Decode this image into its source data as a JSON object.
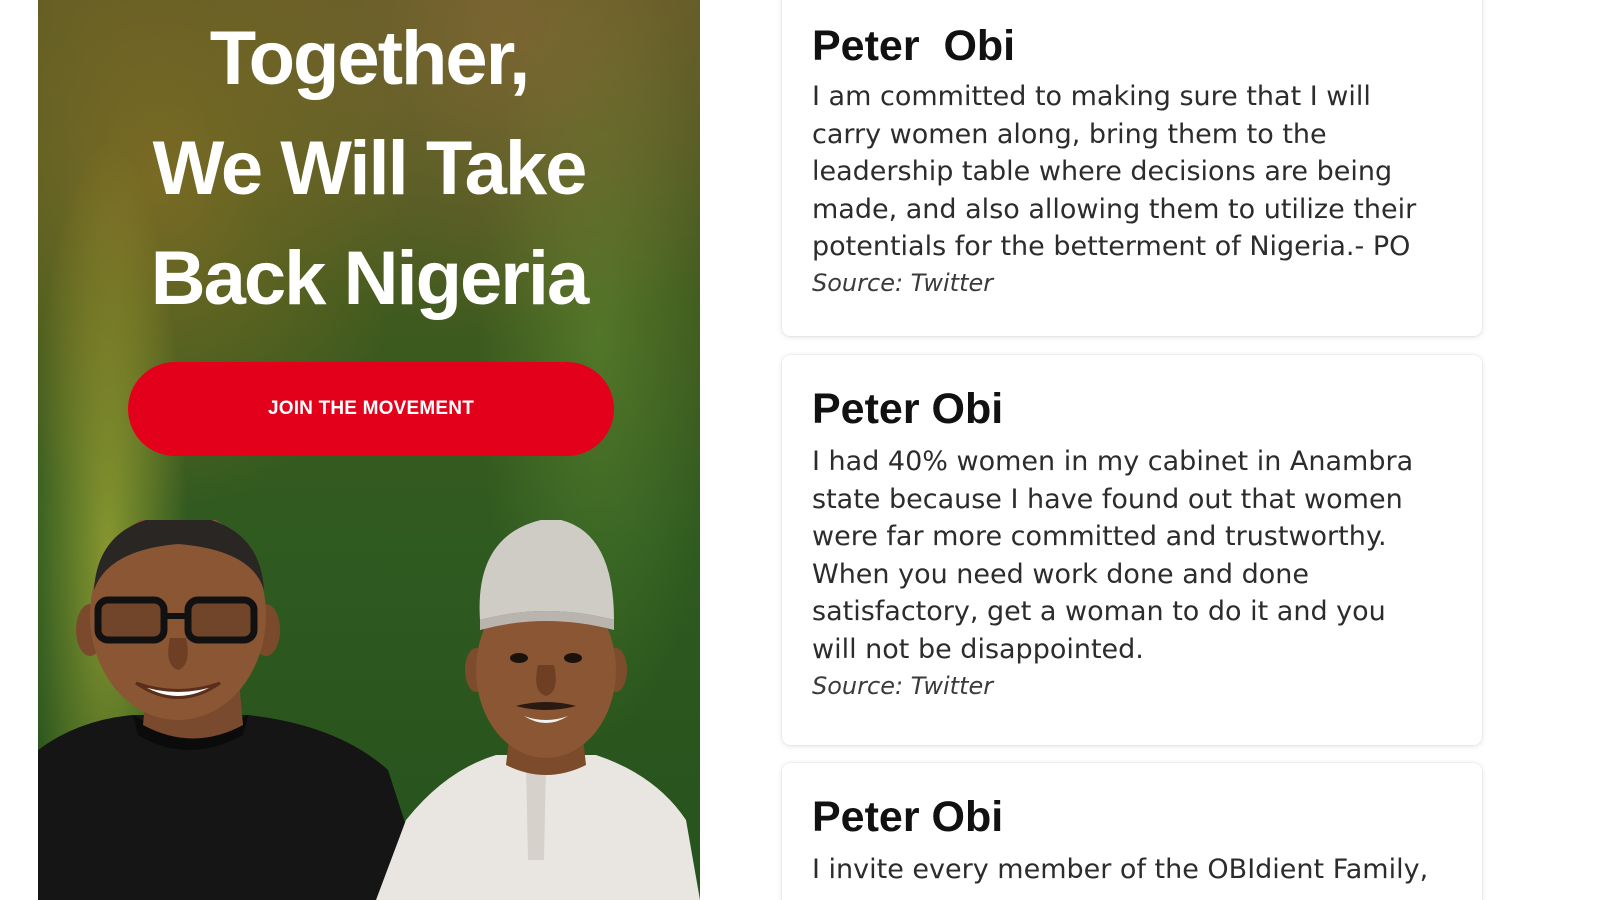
{
  "hero": {
    "title_lines": [
      "Together,",
      "We Will Take",
      "Back Nigeria"
    ],
    "cta_label": "JOIN THE MOVEMENT",
    "colors": {
      "button": "#e3001b",
      "text": "#ffffff",
      "background_green": "#2f5a20"
    }
  },
  "quotes": [
    {
      "name": "Peter  Obi",
      "text": "I am committed to making sure that I will\ncarry women along, bring them to the\nleadership table where decisions are being\nmade, and also allowing them to utilize their\npotentials for the betterment of Nigeria.- PO",
      "source": "Source: Twitter"
    },
    {
      "name": "Peter Obi",
      "text": "I had 40% women in my cabinet in Anambra\nstate because I have found  out that women\nwere far more committed and trustworthy.\nWhen you need work done and done\nsatisfactory, get a woman to do it and you\nwill not be disappointed.",
      "source": "Source: Twitter"
    },
    {
      "name": "Peter Obi",
      "text": "I invite every member of the OBIdient Family,",
      "source": ""
    }
  ]
}
